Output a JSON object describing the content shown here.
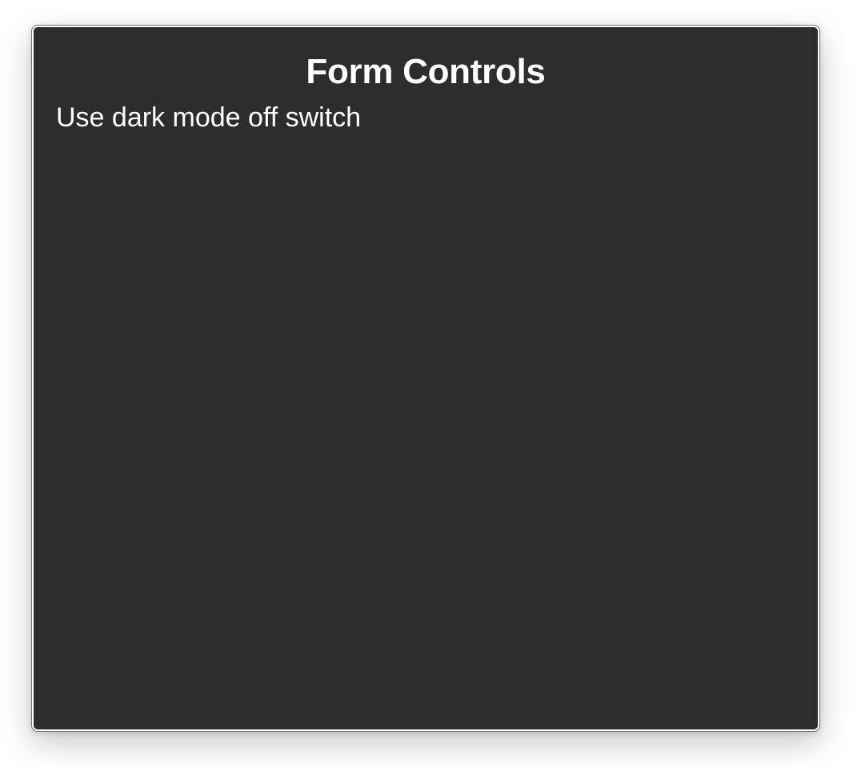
{
  "page": {
    "title": "Form Controls",
    "switch_label": "Use dark mode off switch"
  },
  "colors": {
    "content_background": "#2c2d2f",
    "text": "#ffffff",
    "window_border": "#6f6f6f"
  }
}
